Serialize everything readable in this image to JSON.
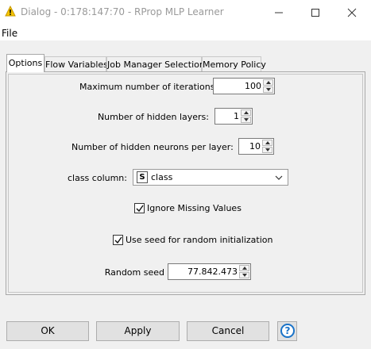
{
  "window": {
    "title": "Dialog - 0:178:147:70 - RProp MLP Learner",
    "app_icon": "knime-warning-triangle-icon",
    "controls": [
      "minimize-icon",
      "maximize-icon",
      "close-icon"
    ]
  },
  "menu": {
    "file_label": "File"
  },
  "tabs": [
    {
      "label": "Options",
      "active": true
    },
    {
      "label": "Flow Variables",
      "active": false
    },
    {
      "label": "Job Manager Selection",
      "active": false
    },
    {
      "label": "Memory Policy",
      "active": false
    }
  ],
  "options": {
    "max_iterations": {
      "label": "Maximum number of iterations:",
      "value": "100"
    },
    "hidden_layers": {
      "label": "Number of hidden layers:",
      "value": "1"
    },
    "hidden_neurons": {
      "label": "Number of hidden neurons per layer:",
      "value": "10"
    },
    "class_column": {
      "label": "class column:",
      "type_badge": "S",
      "value": "class"
    },
    "ignore_missing": {
      "label": "Ignore Missing Values",
      "checked": true
    },
    "use_seed": {
      "label": "Use seed for random initialization",
      "checked": true
    },
    "random_seed": {
      "label": "Random seed",
      "value": "77.842.473"
    }
  },
  "buttons": {
    "ok": "OK",
    "apply": "Apply",
    "cancel": "Cancel",
    "help_icon": "help-icon"
  },
  "colors": {
    "help_accent": "#1a73c8",
    "icon_yellow": "#f5c400"
  }
}
